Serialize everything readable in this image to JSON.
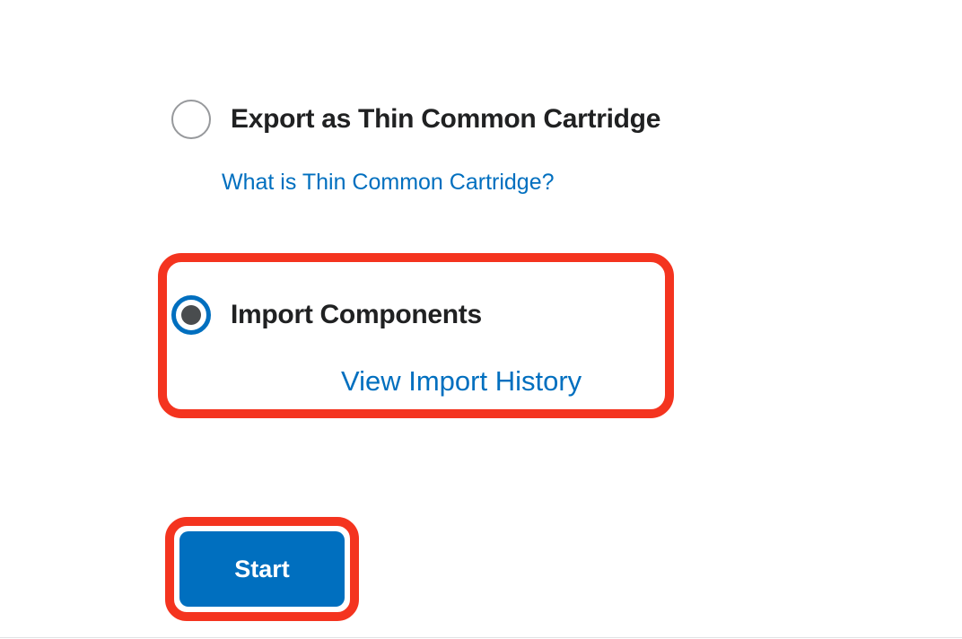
{
  "options": {
    "top_partial_link": "",
    "export": {
      "label": "Export as Thin Common Cartridge",
      "helper": "What is Thin Common Cartridge?",
      "selected": false
    },
    "import": {
      "label": "Import Components",
      "history_link": "View Import History",
      "selected": true
    }
  },
  "actions": {
    "start": "Start"
  },
  "colors": {
    "accent": "#006fbf",
    "highlight": "#f4341f",
    "text": "#202122"
  }
}
